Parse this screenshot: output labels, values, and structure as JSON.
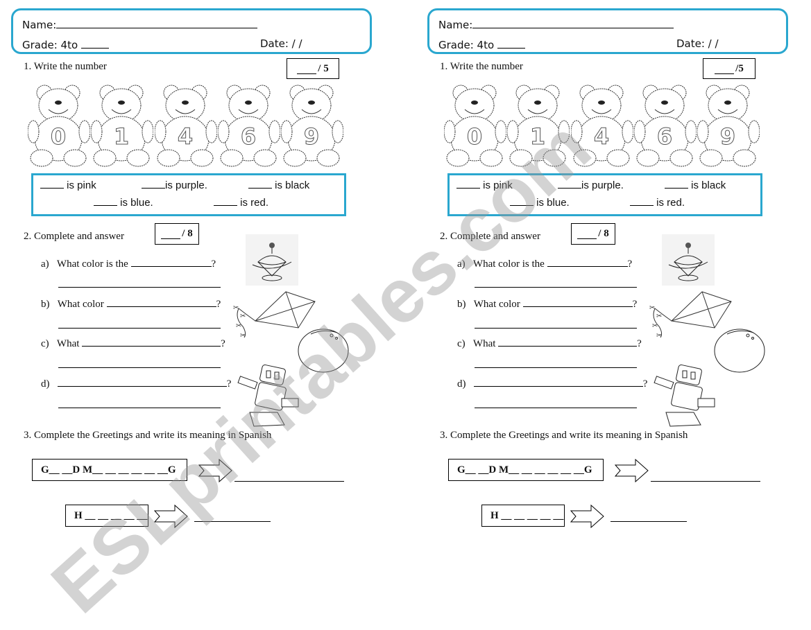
{
  "watermark": "ESLprintables.com",
  "accent_color": "#2aa7cf",
  "pages": [
    {
      "header": {
        "name_label": "Name:",
        "grade_label": "Grade:  4to",
        "date_label": "Date: / /"
      },
      "q1": {
        "label": "1.   Write the number",
        "score": "/ 5"
      },
      "bear_numbers": [
        "0",
        "1",
        "4",
        "6",
        "9"
      ],
      "color_sentences": [
        "is pink",
        "is purple.",
        "is black",
        "is blue.",
        "is red."
      ],
      "q2": {
        "label": "2.   Complete and answer",
        "score": "/ 8",
        "items": [
          {
            "letter": "a)",
            "text": "What color is the"
          },
          {
            "letter": "b)",
            "text": "What color"
          },
          {
            "letter": "c)",
            "text": "What"
          },
          {
            "letter": "d)",
            "text": ""
          }
        ],
        "question_mark": "?"
      },
      "q3": {
        "label": "3.   Complete the Greetings and write its meaning in Spanish",
        "greeting1": "G__ __D M__ __ __ __ __ __G",
        "greeting2": "H __ __ __ __ __"
      }
    },
    {
      "header": {
        "name_label": "Name:",
        "grade_label": "Grade: 4to",
        "date_label": "Date:  /  /"
      },
      "q1": {
        "label": "1.   Write the number",
        "score": "/5"
      },
      "bear_numbers": [
        "0",
        "1",
        "4",
        "6",
        "9"
      ],
      "color_sentences": [
        "is pink",
        "is purple.",
        "is black",
        "is blue.",
        "is red."
      ],
      "q2": {
        "label": "2.   Complete and answer",
        "score": "/ 8",
        "items": [
          {
            "letter": "a)",
            "text": "What color is the"
          },
          {
            "letter": "b)",
            "text": "What color"
          },
          {
            "letter": "c)",
            "text": "What"
          },
          {
            "letter": "d)",
            "text": ""
          }
        ],
        "question_mark": "?"
      },
      "q3": {
        "label": "3.   Complete the Greetings and write its meaning in Spanish",
        "greeting1": "G__ __D M__ __ __ __ __ __G",
        "greeting2": "H __ __ __ __ __"
      }
    }
  ]
}
